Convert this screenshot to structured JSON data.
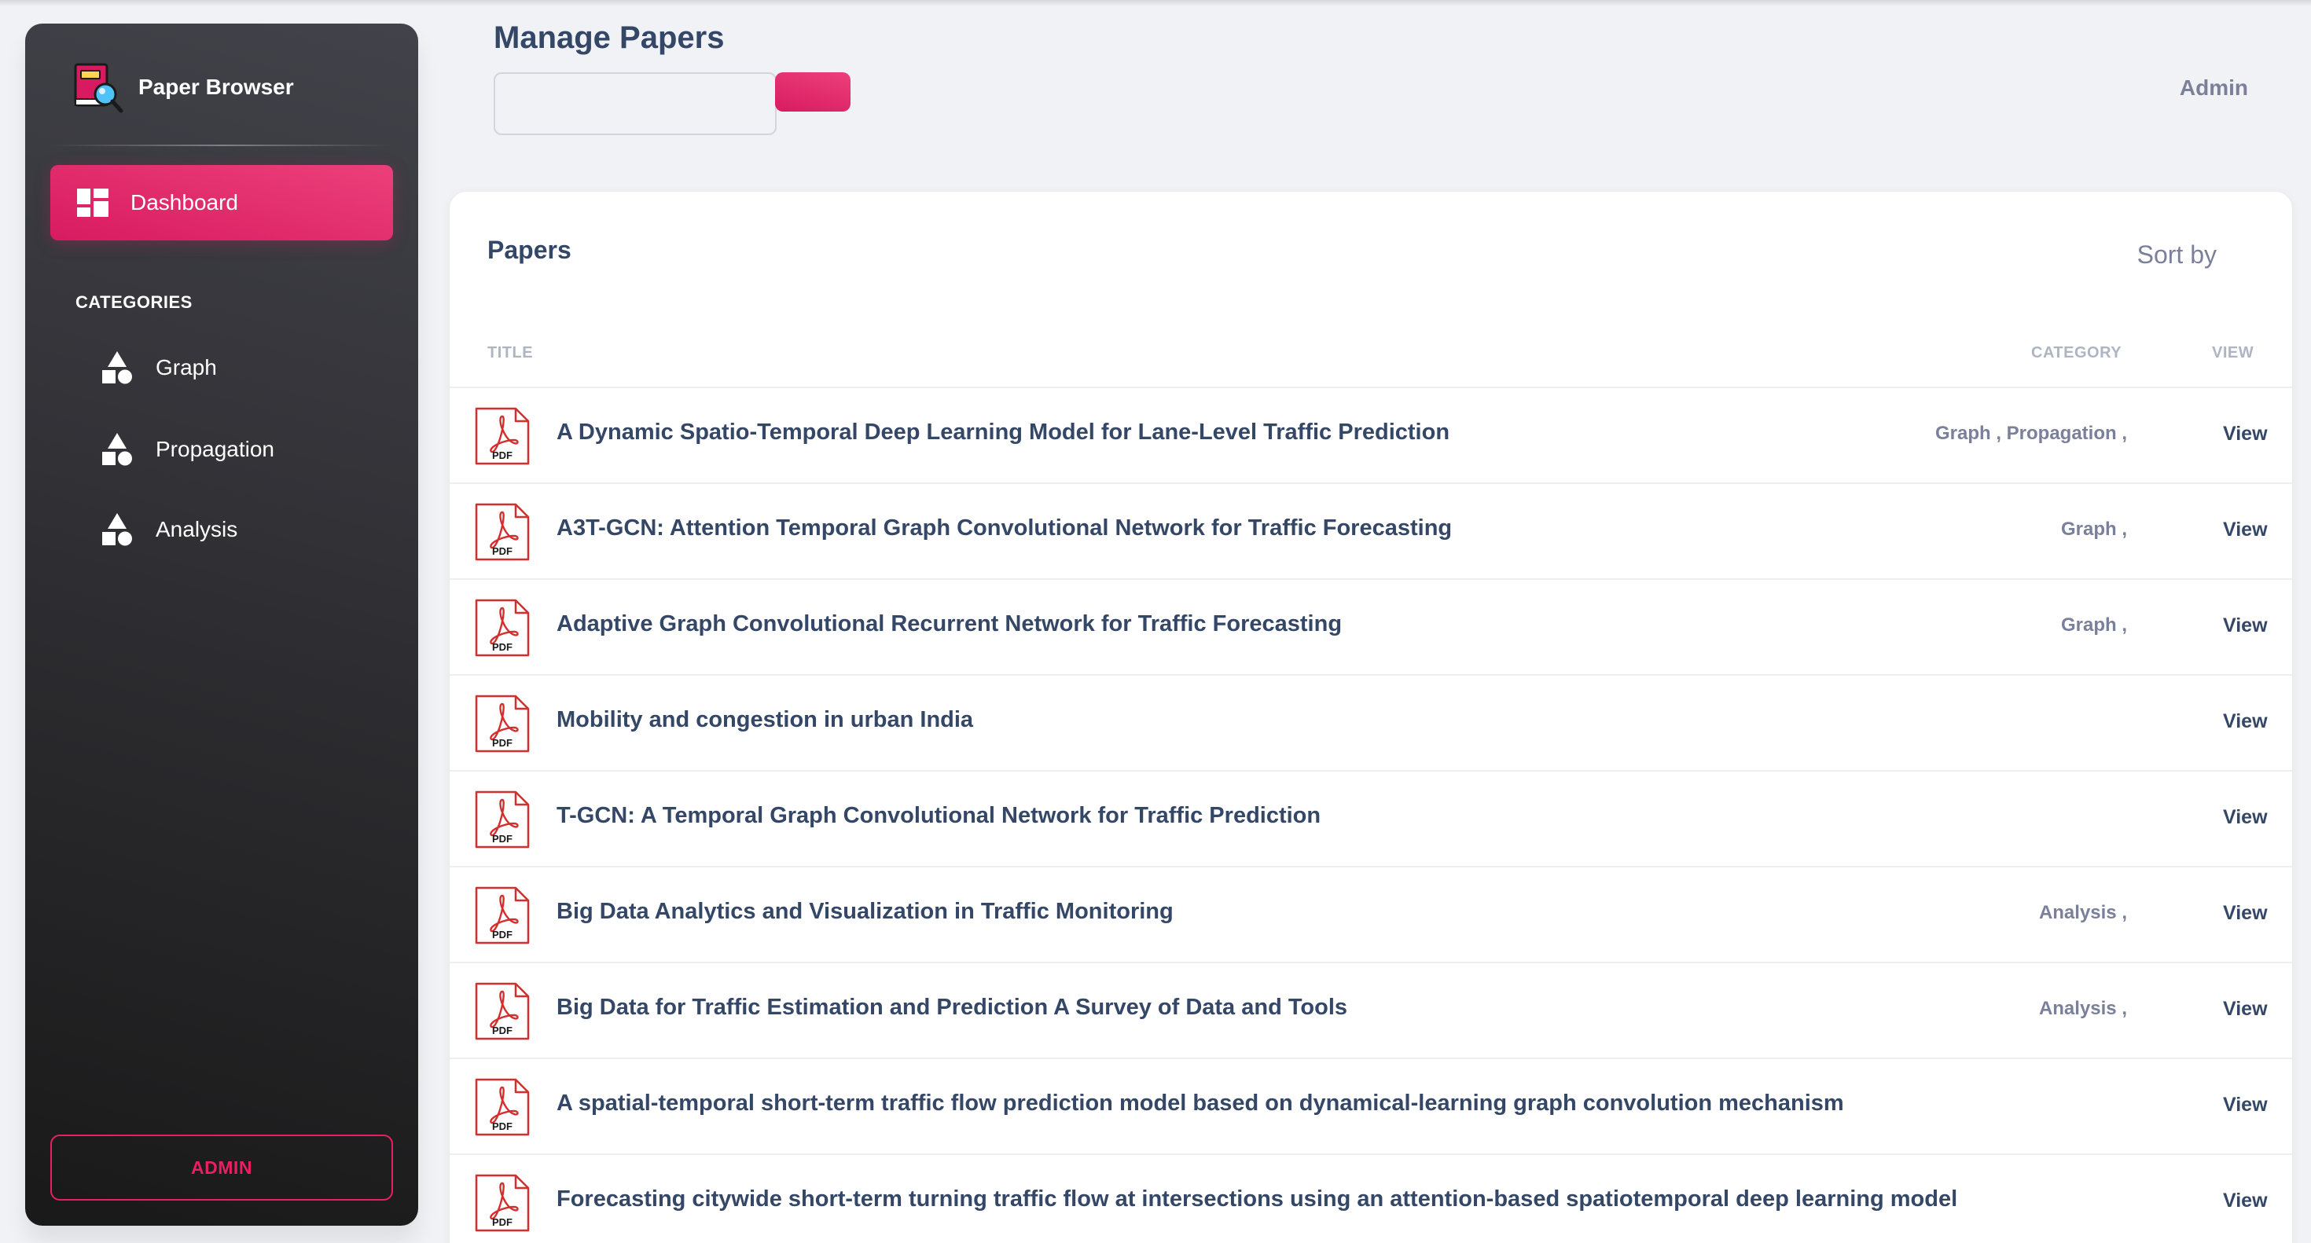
{
  "sidebar": {
    "brand": "Paper Browser",
    "nav": {
      "dashboard_label": "Dashboard"
    },
    "section_label": "CATEGORIES",
    "categories": [
      {
        "label": "Graph"
      },
      {
        "label": "Propagation"
      },
      {
        "label": "Analysis"
      }
    ],
    "admin_button": "ADMIN"
  },
  "header": {
    "title": "Manage Papers",
    "search": {
      "value": "",
      "placeholder": ""
    },
    "user_link": "Admin"
  },
  "papers": {
    "card_title": "Papers",
    "sort_label": "Sort by",
    "columns": {
      "title": "TITLE",
      "category": "CATEGORY",
      "view": "VIEW"
    },
    "pdf_label": "PDF",
    "rows": [
      {
        "title": "A Dynamic Spatio-Temporal Deep Learning Model for Lane-Level Traffic Prediction",
        "category": "Graph , Propagation ,",
        "view": "View"
      },
      {
        "title": "A3T-GCN: Attention Temporal Graph Convolutional Network for Traffic Forecasting",
        "category": "Graph ,",
        "view": "View"
      },
      {
        "title": "Adaptive Graph Convolutional Recurrent Network for Traffic Forecasting",
        "category": "Graph ,",
        "view": "View"
      },
      {
        "title": "Mobility and congestion in urban India",
        "category": "",
        "view": "View"
      },
      {
        "title": "T-GCN: A Temporal Graph Convolutional Network for Traffic Prediction",
        "category": "",
        "view": "View"
      },
      {
        "title": "Big Data Analytics and Visualization in Traffic Monitoring",
        "category": "Analysis ,",
        "view": "View"
      },
      {
        "title": "Big Data for Traffic Estimation and Prediction A Survey of Data and Tools",
        "category": "Analysis ,",
        "view": "View"
      },
      {
        "title": "A spatial-temporal short-term traffic flow prediction model based on dynamical-learning graph convolution mechanism",
        "category": "",
        "view": "View"
      },
      {
        "title": "Forecasting citywide short-term turning traffic flow at intersections using an attention-based spatiotemporal deep learning model",
        "category": "",
        "view": "View"
      }
    ]
  },
  "colors": {
    "accent": "#e91e63",
    "sidebar_dark": "#191919",
    "text_primary": "#344767",
    "text_secondary": "#7b809a",
    "pdf_red": "#d32f2f"
  },
  "icons": {
    "brand": "paper-browser-logo-icon",
    "dashboard": "dashboard-icon",
    "category": "shapes-icon",
    "file": "pdf-file-icon"
  }
}
